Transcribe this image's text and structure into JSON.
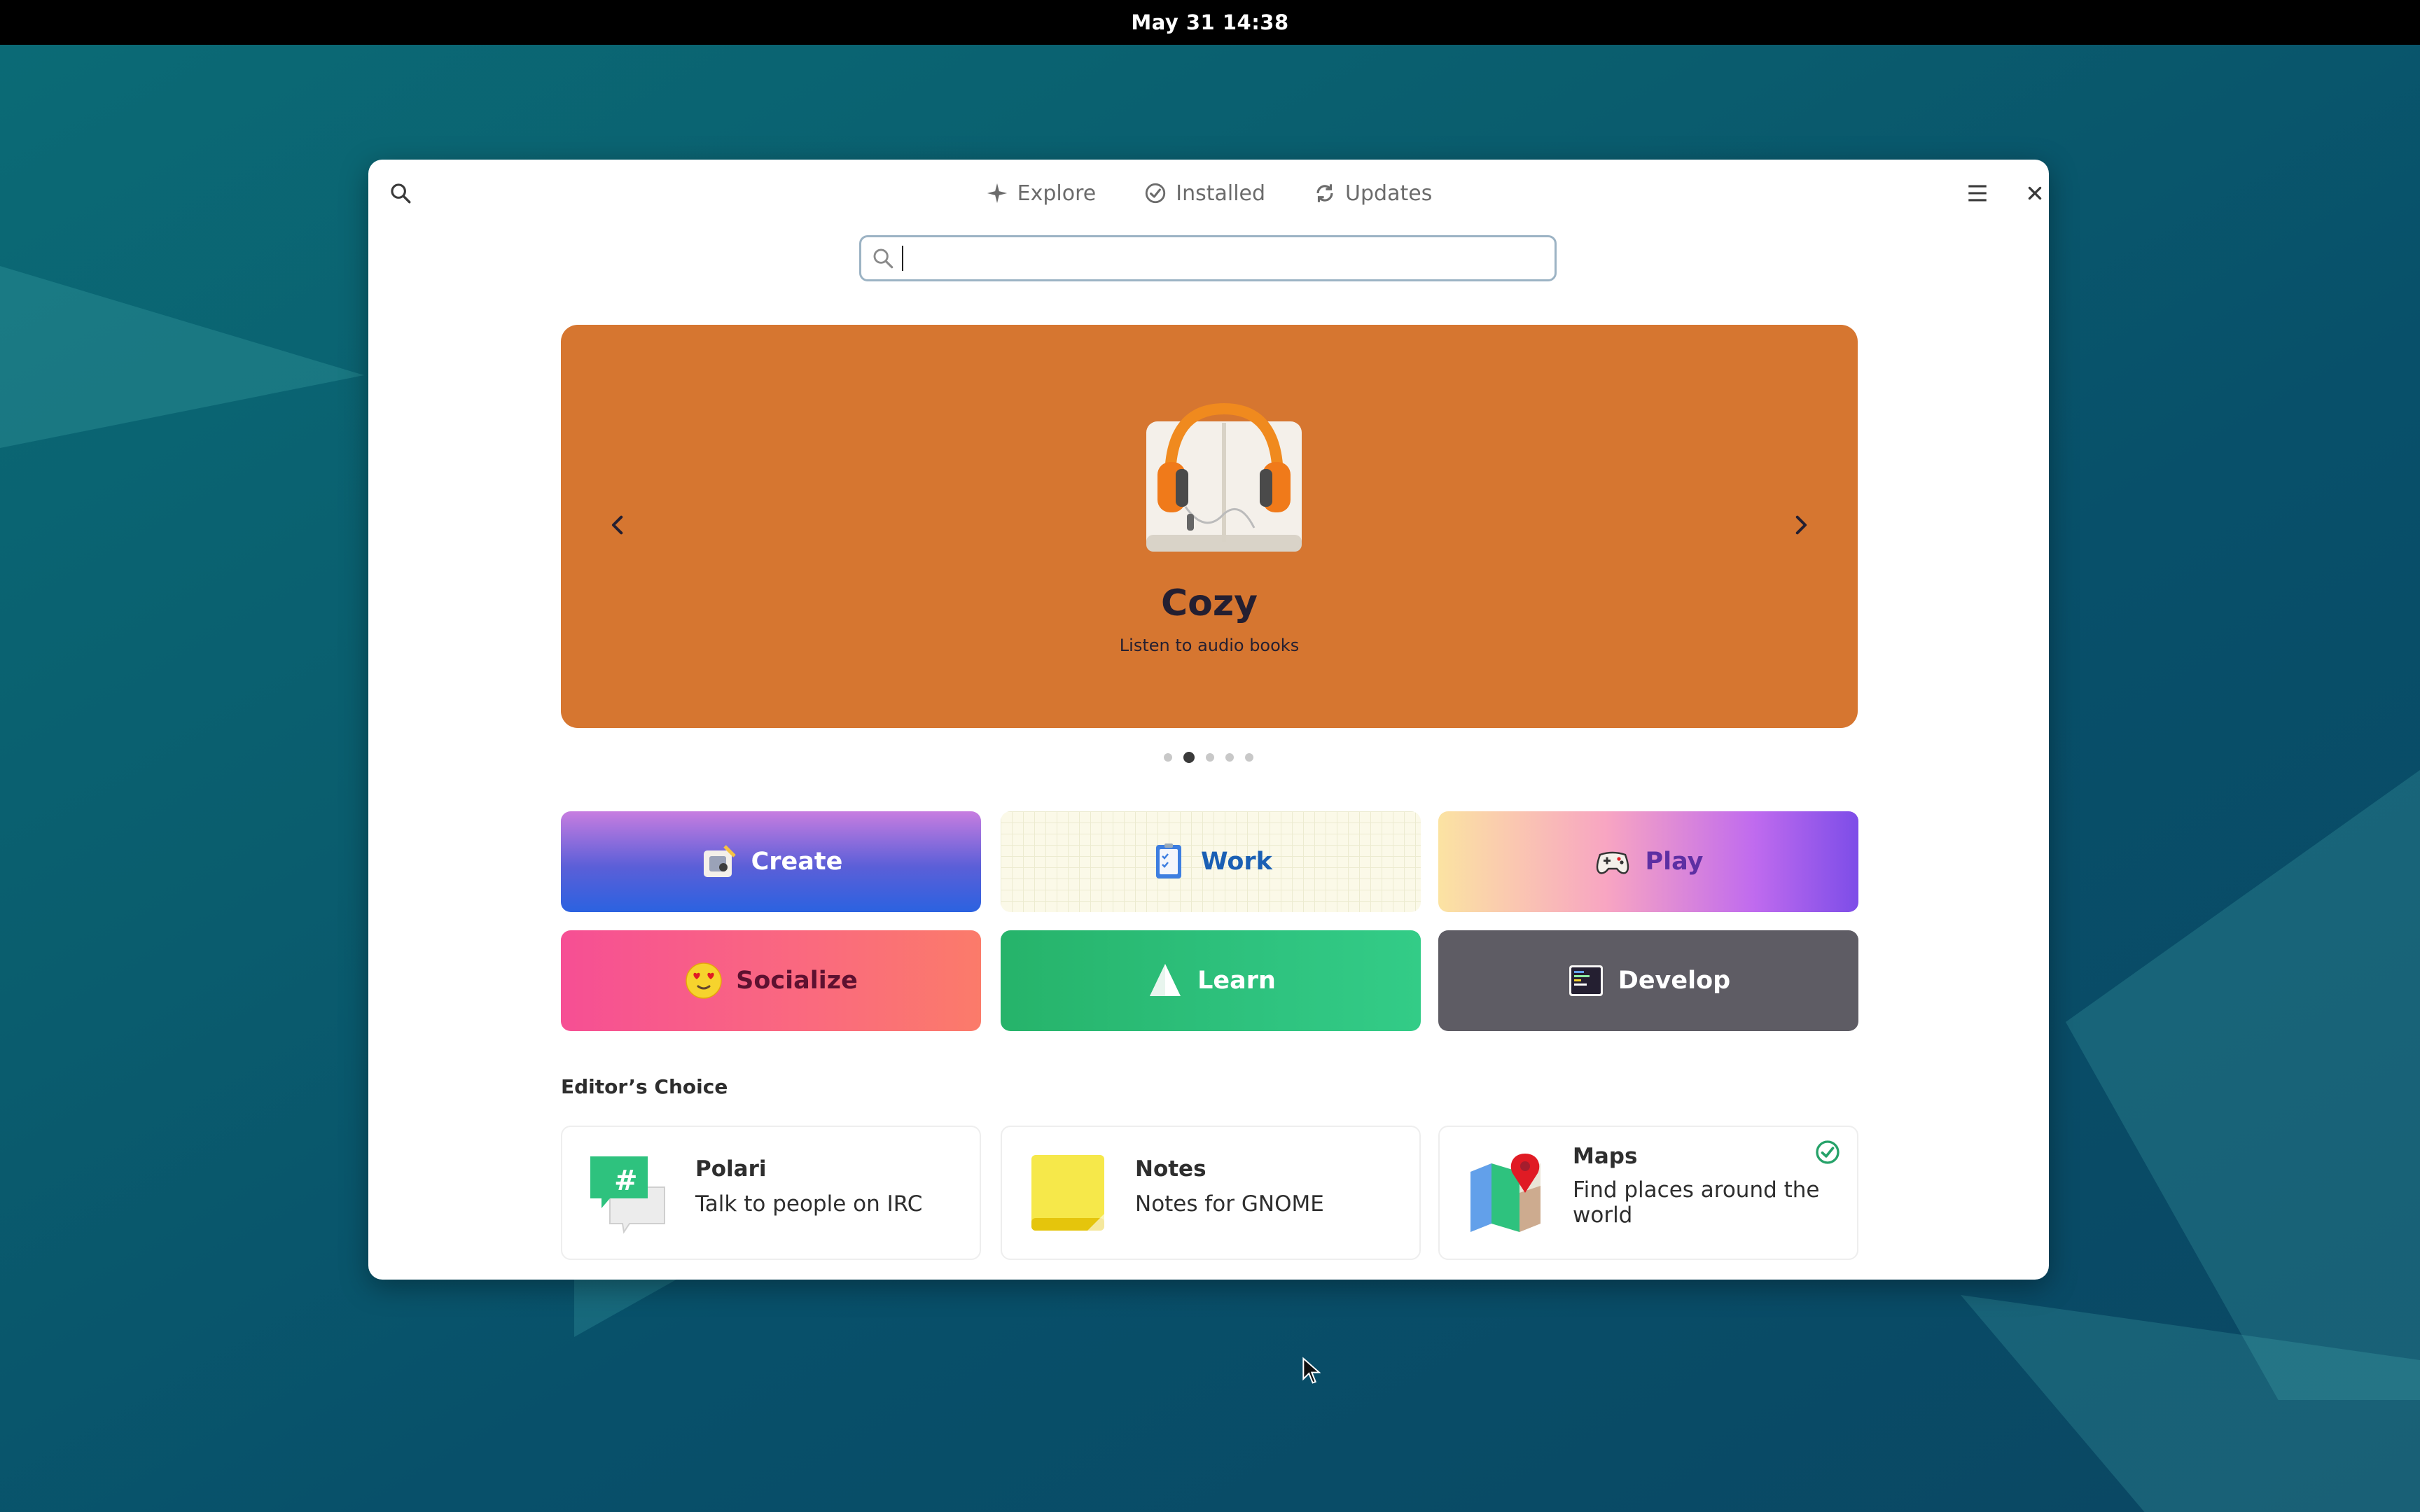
{
  "topbar": {
    "clock": "May 31  14:38"
  },
  "header": {
    "tabs": [
      {
        "label": "Explore",
        "icon": "sparkle-icon"
      },
      {
        "label": "Installed",
        "icon": "check-circle-icon"
      },
      {
        "label": "Updates",
        "icon": "refresh-icon"
      }
    ],
    "search_value": ""
  },
  "carousel": {
    "app_name": "Cozy",
    "app_summary": "Listen to audio books",
    "background": "#d67630",
    "slide_count": 5,
    "active_slide": 2
  },
  "categories": [
    {
      "label": "Create",
      "icon": "create-icon"
    },
    {
      "label": "Work",
      "icon": "work-icon"
    },
    {
      "label": "Play",
      "icon": "gamepad-icon"
    },
    {
      "label": "Socialize",
      "icon": "emoji-heart-eyes-icon"
    },
    {
      "label": "Learn",
      "icon": "learn-icon"
    },
    {
      "label": "Develop",
      "icon": "terminal-icon"
    }
  ],
  "editors_choice": {
    "title": "Editor’s Choice",
    "apps": [
      {
        "name": "Polari",
        "summary": "Talk to people on IRC",
        "installed": false
      },
      {
        "name": "Notes",
        "summary": "Notes for GNOME",
        "installed": false
      },
      {
        "name": "Maps",
        "summary": "Find places around the world",
        "installed": true
      }
    ]
  },
  "colors": {
    "accent": "#3584e4",
    "installed_check": "#26a269"
  }
}
